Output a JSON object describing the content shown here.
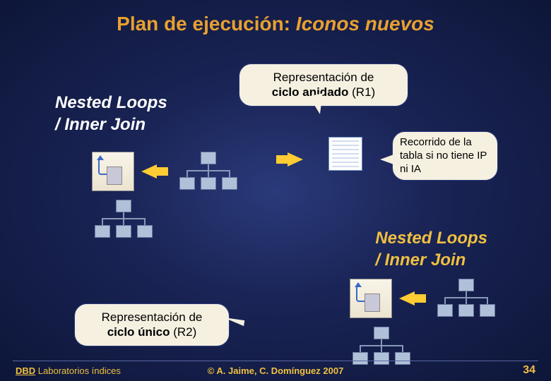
{
  "title": {
    "prefix": "Plan de ejecución: ",
    "emphasis": "Iconos nuevos"
  },
  "labels": {
    "nested_loops_1": "Nested Loops\n/ Inner Join",
    "nested_loops_2": "Nested Loops\n/ Inner Join"
  },
  "callouts": {
    "r1_line1": "Representación de",
    "r1_line2_prefix": "ciclo anidado",
    "r1_line2_suffix": " (R1)",
    "scan_text": "Recorrido de la tabla si no tiene IP ni IA",
    "r2_line1": "Representación de",
    "r2_line2_prefix": "ciclo único",
    "r2_line2_suffix": " (R2)"
  },
  "footer": {
    "link": "DBD",
    "subject": "Laboratorios índices",
    "copyright": "© A. Jaime, C. Domínguez  2007",
    "page": "34"
  },
  "icons": {
    "nested": "nested-loops-icon",
    "table": "table-scan-icon",
    "tree": "tree-plan-icon",
    "arrow": "flow-arrow-icon"
  }
}
